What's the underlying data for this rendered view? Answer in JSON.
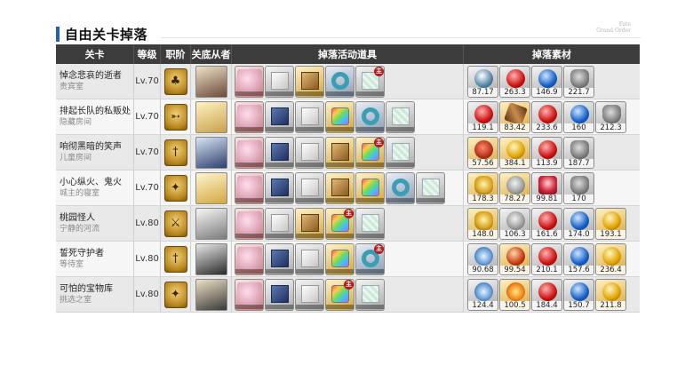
{
  "title": "自由关卡掉落",
  "brand": [
    "Fate",
    "Grand Order"
  ],
  "columns": [
    "关卡",
    "等级",
    "职阶",
    "关底从者",
    "掉落活动道具",
    "掉落素材"
  ],
  "badge_label": "主",
  "rows": [
    {
      "name": "悼念悲哀的逝者",
      "location": "责宾室",
      "level": "Lv.70",
      "class_icon": "fox-class-icon",
      "servant": "dark-haired-servant",
      "items": [
        "pass",
        "cube-white",
        "cube-wood",
        "ring",
        "tile"
      ],
      "badges": [
        4
      ],
      "materials": [
        {
          "icon": "blue-potion",
          "value": "87.17",
          "frame": "silver"
        },
        {
          "icon": "red-gem",
          "value": "263.3",
          "frame": "silver"
        },
        {
          "icon": "blue-gem",
          "value": "146.9",
          "frame": "silver"
        },
        {
          "icon": "skull",
          "value": "221.7",
          "frame": "silver"
        }
      ]
    },
    {
      "name": "排起长队的私贩处",
      "location": "隐藏房间",
      "level": "Lv.70",
      "class_icon": "bow-class-icon",
      "servant": "blond-servant",
      "items": [
        "pass",
        "cube-blue",
        "cube-white",
        "cube-rainbow",
        "ring",
        "tile"
      ],
      "badges": [],
      "materials": [
        {
          "icon": "red-flask",
          "value": "119.1",
          "frame": "silver"
        },
        {
          "icon": "wooden-club",
          "value": "83.42",
          "frame": "gold"
        },
        {
          "icon": "red-gem",
          "value": "233.6",
          "frame": "silver"
        },
        {
          "icon": "blue-gem",
          "value": "160",
          "frame": "silver"
        },
        {
          "icon": "skull",
          "value": "212.3",
          "frame": "silver"
        }
      ]
    },
    {
      "name": "响彻黑暗的笑声",
      "location": "儿童房间",
      "level": "Lv.70",
      "class_icon": "sword-class-icon",
      "servant": "blue-armored-servant",
      "items": [
        "pass",
        "cube-blue",
        "cube-white",
        "cube-wood",
        "cube-rainbow",
        "tile"
      ],
      "badges": [
        4
      ],
      "materials": [
        {
          "icon": "red-cup",
          "value": "57.56",
          "frame": "gold"
        },
        {
          "icon": "gold-star",
          "value": "384.1",
          "frame": "gold"
        },
        {
          "icon": "red-gem",
          "value": "113.9",
          "frame": "silver"
        },
        {
          "icon": "skull",
          "value": "187.7",
          "frame": "silver"
        }
      ]
    },
    {
      "name": "小心纵火、鬼火",
      "location": "城主的寝室",
      "level": "Lv.70",
      "class_icon": "caster-class-icon",
      "servant": "golden-servant",
      "items": [
        "pass",
        "cube-blue",
        "cube-white",
        "cube-wood",
        "cube-rainbow",
        "ring",
        "tile"
      ],
      "badges": [],
      "materials": [
        {
          "icon": "gold-lamp",
          "value": "178.3",
          "frame": "gold"
        },
        {
          "icon": "grey-bottle",
          "value": "78.27",
          "frame": "gold"
        },
        {
          "icon": "red-crest",
          "value": "99.81",
          "frame": "silver"
        },
        {
          "icon": "skull",
          "value": "170",
          "frame": "silver"
        }
      ]
    },
    {
      "name": "桃园怪人",
      "location": "宁静的河流",
      "level": "Lv.80",
      "class_icon": "rider-class-icon",
      "servant": "white-haired-servant",
      "items": [
        "pass",
        "cube-white",
        "cube-wood",
        "cube-rainbow",
        "tile"
      ],
      "badges": [
        3
      ],
      "materials": [
        {
          "icon": "gold-lamp",
          "value": "148.0",
          "frame": "gold"
        },
        {
          "icon": "grey-bottle",
          "value": "106.3",
          "frame": "silver"
        },
        {
          "icon": "red-gem",
          "value": "161.6",
          "frame": "silver"
        },
        {
          "icon": "blue-gem",
          "value": "174.0",
          "frame": "silver"
        },
        {
          "icon": "gold-statue",
          "value": "193.1",
          "frame": "gold"
        }
      ]
    },
    {
      "name": "誓死守护者",
      "location": "等待室",
      "level": "Lv.80",
      "class_icon": "sword-class-icon",
      "servant": "dark-coat-servant",
      "items": [
        "pass",
        "cube-blue",
        "cube-white",
        "cube-rainbow",
        "ring"
      ],
      "badges": [
        4
      ],
      "materials": [
        {
          "icon": "pendant",
          "value": "90.68",
          "frame": "silver"
        },
        {
          "icon": "red-bead",
          "value": "99.54",
          "frame": "gold"
        },
        {
          "icon": "red-gem",
          "value": "210.1",
          "frame": "silver"
        },
        {
          "icon": "blue-gem",
          "value": "157.6",
          "frame": "silver"
        },
        {
          "icon": "gold-statue",
          "value": "236.4",
          "frame": "gold"
        }
      ]
    },
    {
      "name": "可怕的宝物库",
      "location": "挑选之室",
      "level": "Lv.80",
      "class_icon": "caster-class-icon",
      "servant": "armored-servant",
      "items": [
        "pass",
        "cube-blue",
        "cube-white",
        "cube-rainbow",
        "tile"
      ],
      "badges": [
        3
      ],
      "materials": [
        {
          "icon": "pendant",
          "value": "124.4",
          "frame": "silver"
        },
        {
          "icon": "gold-flower",
          "value": "100.5",
          "frame": "gold"
        },
        {
          "icon": "red-gem",
          "value": "184.4",
          "frame": "silver"
        },
        {
          "icon": "blue-gem",
          "value": "150.7",
          "frame": "silver"
        },
        {
          "icon": "gold-statue",
          "value": "211.8",
          "frame": "gold"
        }
      ]
    }
  ],
  "colors": {
    "header": "#3c3c3c",
    "accent": "#1f5fb5",
    "badge": "#b3191b"
  }
}
